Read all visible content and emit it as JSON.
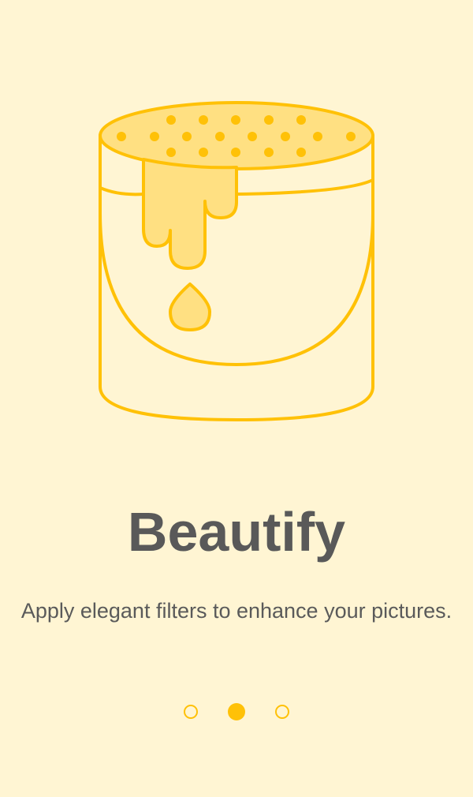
{
  "onboarding": {
    "title": "Beautify",
    "subtitle": "Apply elegant filters to enhance your pictures.",
    "illustration_icon": "paint-bucket-icon",
    "current_page": 2,
    "total_pages": 3
  },
  "colors": {
    "background": "#FFF5D3",
    "accent": "#FFC107",
    "paint_fill": "#FFE082",
    "text_primary": "#595959"
  }
}
